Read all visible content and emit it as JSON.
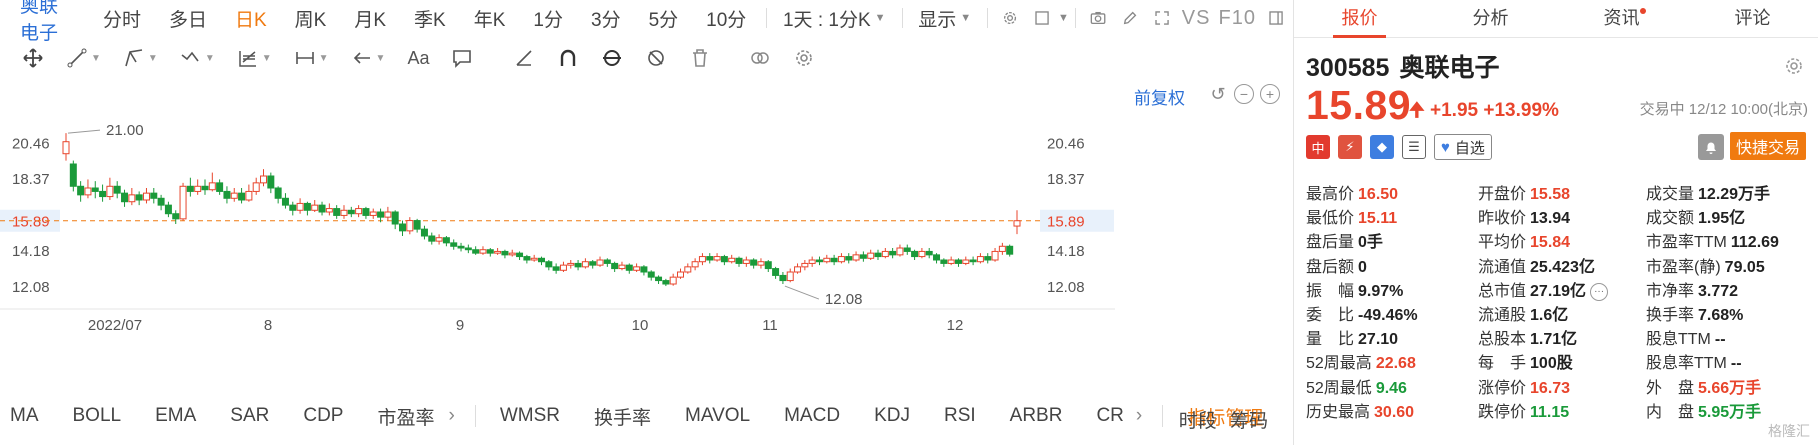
{
  "toolbar": {
    "stock_name": "奥联电子",
    "periods": [
      "分时",
      "多日",
      "日K",
      "周K",
      "月K",
      "季K",
      "年K",
      "1分",
      "3分",
      "5分",
      "10分"
    ],
    "active_period": "日K",
    "interval_select": "1天 : 1分K",
    "display_label": "显示",
    "vs_label": "VS",
    "f10_label": "F10"
  },
  "draw_tools": {
    "text_tool_label": "Aa"
  },
  "chart_controls": {
    "adjust_label": "前复权",
    "zoom_out": "−",
    "zoom_in": "+"
  },
  "chart_data": {
    "type": "candlestick",
    "y_ticks": [
      "20.46",
      "18.37",
      "15.89",
      "14.18",
      "12.08"
    ],
    "y_tick_values": [
      20.46,
      18.37,
      15.89,
      14.18,
      12.08
    ],
    "current_price_label": "15.89",
    "current_price": 15.89,
    "x_labels": [
      "2022/07",
      "8",
      "9",
      "10",
      "11",
      "12"
    ],
    "annotations": [
      {
        "text": "21.00",
        "value": 21.0,
        "candle_index": 0
      },
      {
        "text": "12.08",
        "value": 12.08,
        "candle_index": 98
      }
    ],
    "ylim": [
      10.8,
      22.0
    ],
    "candles": [
      [
        19.8,
        20.5,
        21.0,
        19.4
      ],
      [
        19.2,
        17.9,
        19.4,
        17.6
      ],
      [
        17.9,
        17.4,
        18.2,
        17.0
      ],
      [
        17.4,
        17.8,
        18.3,
        17.2
      ],
      [
        17.8,
        17.6,
        18.2,
        17.2
      ],
      [
        17.6,
        17.3,
        18.0,
        17.0
      ],
      [
        17.3,
        17.9,
        18.4,
        17.1
      ],
      [
        17.9,
        17.5,
        18.2,
        17.2
      ],
      [
        17.5,
        17.0,
        17.7,
        16.7
      ],
      [
        17.0,
        17.4,
        17.8,
        16.8
      ],
      [
        17.4,
        17.1,
        17.6,
        16.8
      ],
      [
        17.1,
        17.5,
        17.8,
        16.9
      ],
      [
        17.5,
        17.2,
        17.8,
        16.9
      ],
      [
        17.2,
        16.8,
        17.4,
        16.5
      ],
      [
        16.8,
        16.3,
        17.0,
        16.1
      ],
      [
        16.3,
        16.0,
        16.5,
        15.7
      ],
      [
        16.0,
        17.9,
        18.1,
        15.9
      ],
      [
        17.9,
        17.6,
        18.4,
        17.3
      ],
      [
        17.6,
        17.9,
        18.3,
        17.4
      ],
      [
        17.9,
        17.7,
        18.3,
        17.4
      ],
      [
        17.7,
        18.1,
        18.7,
        17.6
      ],
      [
        18.1,
        17.6,
        18.3,
        17.4
      ],
      [
        17.6,
        17.2,
        17.9,
        16.9
      ],
      [
        17.2,
        17.5,
        17.8,
        17.0
      ],
      [
        17.5,
        17.1,
        17.8,
        16.9
      ],
      [
        17.1,
        17.6,
        18.0,
        17.0
      ],
      [
        17.6,
        18.1,
        18.4,
        17.4
      ],
      [
        18.1,
        18.5,
        18.9,
        17.9
      ],
      [
        18.5,
        17.8,
        18.7,
        17.5
      ],
      [
        17.8,
        17.2,
        17.9,
        16.9
      ],
      [
        17.2,
        16.8,
        17.5,
        16.6
      ],
      [
        16.8,
        16.5,
        17.0,
        16.2
      ],
      [
        16.5,
        16.9,
        17.2,
        16.3
      ],
      [
        16.9,
        16.5,
        17.0,
        16.2
      ],
      [
        16.5,
        16.8,
        17.1,
        16.4
      ],
      [
        16.8,
        16.4,
        17.0,
        16.2
      ],
      [
        16.4,
        16.6,
        16.9,
        16.2
      ],
      [
        16.6,
        16.2,
        16.8,
        16.0
      ],
      [
        16.2,
        16.5,
        16.8,
        16.0
      ],
      [
        16.5,
        16.3,
        16.7,
        16.1
      ],
      [
        16.3,
        16.6,
        16.8,
        16.1
      ],
      [
        16.6,
        16.2,
        16.7,
        16.0
      ],
      [
        16.2,
        16.4,
        16.6,
        16.0
      ],
      [
        16.4,
        16.1,
        16.6,
        15.8
      ],
      [
        16.1,
        16.4,
        16.7,
        15.9
      ],
      [
        16.4,
        15.7,
        16.5,
        15.4
      ],
      [
        15.7,
        15.3,
        15.9,
        15.0
      ],
      [
        15.3,
        15.9,
        16.1,
        15.1
      ],
      [
        15.9,
        15.4,
        16.0,
        15.2
      ],
      [
        15.4,
        15.0,
        15.6,
        14.8
      ],
      [
        15.0,
        14.7,
        15.2,
        14.5
      ],
      [
        14.7,
        14.9,
        15.1,
        14.5
      ],
      [
        14.9,
        14.6,
        15.0,
        14.4
      ],
      [
        14.6,
        14.4,
        14.8,
        14.2
      ],
      [
        14.4,
        14.3,
        14.6,
        14.1
      ],
      [
        14.3,
        14.2,
        14.5,
        14.0
      ],
      [
        14.2,
        14.0,
        14.4,
        13.9
      ],
      [
        14.0,
        14.2,
        14.4,
        13.9
      ],
      [
        14.2,
        14.0,
        14.3,
        13.8
      ],
      [
        14.0,
        14.1,
        14.3,
        13.9
      ],
      [
        14.1,
        13.9,
        14.2,
        13.7
      ],
      [
        13.9,
        14.0,
        14.2,
        13.8
      ],
      [
        14.0,
        13.8,
        14.1,
        13.6
      ],
      [
        13.8,
        13.6,
        13.9,
        13.4
      ],
      [
        13.6,
        13.7,
        13.9,
        13.5
      ],
      [
        13.7,
        13.5,
        13.8,
        13.3
      ],
      [
        13.5,
        13.2,
        13.6,
        13.0
      ],
      [
        13.2,
        13.0,
        13.4,
        12.8
      ],
      [
        13.0,
        13.3,
        13.5,
        12.9
      ],
      [
        13.3,
        13.4,
        13.6,
        13.1
      ],
      [
        13.4,
        13.2,
        13.6,
        13.0
      ],
      [
        13.2,
        13.5,
        13.7,
        13.1
      ],
      [
        13.5,
        13.3,
        13.6,
        13.1
      ],
      [
        13.3,
        13.6,
        13.8,
        13.2
      ],
      [
        13.6,
        13.4,
        13.7,
        13.2
      ],
      [
        13.4,
        13.1,
        13.5,
        12.9
      ],
      [
        13.1,
        13.3,
        13.5,
        13.0
      ],
      [
        13.3,
        13.0,
        13.4,
        12.8
      ],
      [
        13.0,
        13.2,
        13.4,
        12.9
      ],
      [
        13.2,
        12.9,
        13.3,
        12.7
      ],
      [
        12.9,
        12.6,
        13.0,
        12.4
      ],
      [
        12.6,
        12.4,
        12.7,
        12.2
      ],
      [
        12.4,
        12.2,
        12.5,
        12.08
      ],
      [
        12.2,
        12.6,
        12.8,
        12.1
      ],
      [
        12.6,
        12.9,
        13.1,
        12.5
      ],
      [
        12.9,
        13.2,
        13.4,
        12.8
      ],
      [
        13.2,
        13.5,
        13.7,
        13.0
      ],
      [
        13.5,
        13.8,
        14.0,
        13.3
      ],
      [
        13.8,
        13.6,
        14.0,
        13.4
      ],
      [
        13.6,
        13.8,
        14.0,
        13.5
      ],
      [
        13.8,
        13.5,
        13.9,
        13.3
      ],
      [
        13.5,
        13.7,
        13.9,
        13.4
      ],
      [
        13.7,
        13.4,
        13.8,
        13.2
      ],
      [
        13.4,
        13.6,
        13.8,
        13.2
      ],
      [
        13.6,
        13.3,
        13.7,
        13.1
      ],
      [
        13.3,
        13.5,
        13.7,
        13.1
      ],
      [
        13.5,
        13.1,
        13.6,
        12.9
      ],
      [
        13.1,
        12.7,
        13.2,
        12.5
      ],
      [
        12.7,
        12.4,
        12.9,
        12.2
      ],
      [
        12.4,
        12.9,
        13.1,
        12.3
      ],
      [
        12.9,
        13.2,
        13.4,
        12.8
      ],
      [
        13.2,
        13.4,
        13.6,
        13.0
      ],
      [
        13.4,
        13.6,
        13.8,
        13.2
      ],
      [
        13.6,
        13.5,
        13.8,
        13.3
      ],
      [
        13.5,
        13.7,
        13.9,
        13.4
      ],
      [
        13.7,
        13.5,
        13.9,
        13.3
      ],
      [
        13.5,
        13.8,
        14.0,
        13.4
      ],
      [
        13.8,
        13.6,
        14.0,
        13.4
      ],
      [
        13.6,
        13.9,
        14.1,
        13.5
      ],
      [
        13.9,
        13.7,
        14.1,
        13.5
      ],
      [
        13.7,
        14.0,
        14.2,
        13.6
      ],
      [
        14.0,
        13.8,
        14.2,
        13.6
      ],
      [
        13.8,
        14.1,
        14.3,
        13.7
      ],
      [
        14.1,
        13.9,
        14.3,
        13.7
      ],
      [
        13.9,
        14.3,
        14.5,
        13.8
      ],
      [
        14.3,
        14.1,
        14.5,
        13.9
      ],
      [
        14.1,
        13.8,
        14.2,
        13.6
      ],
      [
        13.8,
        14.1,
        14.3,
        13.7
      ],
      [
        14.1,
        13.9,
        14.3,
        13.7
      ],
      [
        13.9,
        13.6,
        14.0,
        13.4
      ],
      [
        13.6,
        13.4,
        13.7,
        13.2
      ],
      [
        13.4,
        13.6,
        13.8,
        13.3
      ],
      [
        13.6,
        13.4,
        13.7,
        13.2
      ],
      [
        13.4,
        13.6,
        13.8,
        13.3
      ],
      [
        13.6,
        13.5,
        13.8,
        13.3
      ],
      [
        13.5,
        13.8,
        14.0,
        13.4
      ],
      [
        13.8,
        13.6,
        14.0,
        13.4
      ],
      [
        13.6,
        14.1,
        14.3,
        13.5
      ],
      [
        14.1,
        14.4,
        14.6,
        13.9
      ],
      [
        14.4,
        13.94,
        14.5,
        13.8
      ],
      [
        15.58,
        15.89,
        16.5,
        15.11
      ]
    ],
    "event_marker_candles": [
      0,
      4,
      38,
      43,
      44,
      46,
      56,
      63,
      84,
      88,
      89,
      91,
      94,
      125
    ],
    "colors": {
      "up": "#e8452c",
      "down": "#1a9a3a",
      "price_line": "#f07a10",
      "marker": "#3e7ee0"
    }
  },
  "indicators": {
    "items": [
      "MA",
      "BOLL",
      "EMA",
      "SAR",
      "CDP",
      "市盈率"
    ],
    "items2": [
      "WMSR",
      "换手率",
      "MAVOL",
      "MACD",
      "KDJ",
      "RSI",
      "ARBR",
      "CR"
    ],
    "manage_label": "指标管理",
    "right_labels": [
      "时段",
      "筹码"
    ]
  },
  "quote": {
    "tabs": [
      "报价",
      "分析",
      "资讯",
      "评论"
    ],
    "active_tab": "报价",
    "code": "300585",
    "name": "奥联电子",
    "price": "15.89",
    "change": "+1.95",
    "change_pct": "+13.99%",
    "status": "交易中 12/12 10:00(北京)",
    "watch_label": "自选",
    "fast_trade_label": "快捷交易",
    "badge_cn": "中",
    "rows": [
      [
        {
          "l": "最高价",
          "v": "16.50",
          "c": "up"
        },
        {
          "l": "开盘价",
          "v": "15.58",
          "c": "up"
        },
        {
          "l": "成交量",
          "v": "12.29万手",
          "c": "neu"
        }
      ],
      [
        {
          "l": "最低价",
          "v": "15.11",
          "c": "up"
        },
        {
          "l": "昨收价",
          "v": "13.94",
          "c": "neu"
        },
        {
          "l": "成交额",
          "v": "1.95亿",
          "c": "neu"
        }
      ],
      [
        {
          "l": "盘后量",
          "v": "0手",
          "c": "neu"
        },
        {
          "l": "平均价",
          "v": "15.84",
          "c": "up"
        },
        {
          "l": "市盈率TTM",
          "v": "112.69",
          "c": "neu"
        }
      ],
      [
        {
          "l": "盘后额",
          "v": "0",
          "c": "neu"
        },
        {
          "l": "流通值",
          "v": "25.423亿",
          "c": "neu"
        },
        {
          "l": "市盈率(静)",
          "v": "79.05",
          "c": "neu"
        }
      ],
      [
        {
          "l": "振　幅",
          "v": "9.97%",
          "c": "neu"
        },
        {
          "l": "总市值",
          "v": "27.19亿",
          "c": "neu"
        },
        {
          "l": "市净率",
          "v": "3.772",
          "c": "neu"
        }
      ],
      [
        {
          "l": "委　比",
          "v": "-49.46%",
          "c": "neu"
        },
        {
          "l": "流通股",
          "v": "1.6亿",
          "c": "neu"
        },
        {
          "l": "换手率",
          "v": "7.68%",
          "c": "neu"
        }
      ],
      [
        {
          "l": "量　比",
          "v": "27.10",
          "c": "neu"
        },
        {
          "l": "总股本",
          "v": "1.71亿",
          "c": "neu"
        },
        {
          "l": "股息TTM",
          "v": "--",
          "c": "neu"
        }
      ],
      [
        {
          "l": "52周最高",
          "v": "22.68",
          "c": "up"
        },
        {
          "l": "每　手",
          "v": "100股",
          "c": "neu"
        },
        {
          "l": "股息率TTM",
          "v": "--",
          "c": "neu"
        }
      ],
      [
        {
          "l": "52周最低",
          "v": "9.46",
          "c": "down"
        },
        {
          "l": "涨停价",
          "v": "16.73",
          "c": "up"
        },
        {
          "l": "外　盘",
          "v": "5.66万手",
          "c": "up"
        }
      ],
      [
        {
          "l": "历史最高",
          "v": "30.60",
          "c": "up"
        },
        {
          "l": "跌停价",
          "v": "11.15",
          "c": "down"
        },
        {
          "l": "内　盘",
          "v": "5.95万手",
          "c": "down"
        }
      ]
    ],
    "watermark": "格隆汇"
  }
}
